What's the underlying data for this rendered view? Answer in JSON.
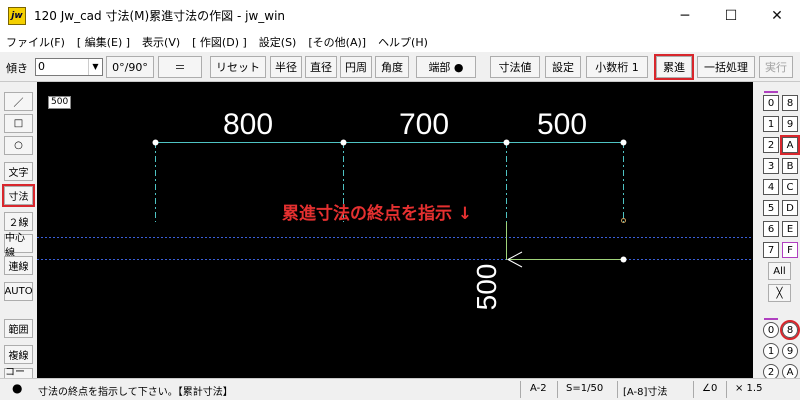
{
  "window": {
    "title": "120 Jw_cad 寸法(M)累進寸法の作図 - jw_win",
    "icon_text": "jw"
  },
  "menu": [
    "ファイル(F)",
    "[ 編集(E) ]",
    "表示(V)",
    "[ 作図(D) ]",
    "設定(S)",
    "[その他(A)]",
    "ヘルプ(H)"
  ],
  "toolbar": {
    "angle_label": "傾き",
    "angle_value": "0",
    "buttons": [
      "0°/90°",
      "＝",
      "リセット",
      "半径",
      "直径",
      "円周",
      "角度",
      "端部 ●",
      "寸法値",
      "設定",
      "小数桁 1",
      "累進",
      "一括処理",
      "実行"
    ]
  },
  "left_tools": [
    "／",
    "□",
    "○",
    "文字",
    "寸法",
    "２線",
    "中心線",
    "連線",
    "AUTO",
    "範囲",
    "複線",
    "コーナー"
  ],
  "right_panel": {
    "layers_left": [
      "0",
      "1",
      "2",
      "3",
      "4",
      "5",
      "6",
      "7"
    ],
    "layers_right": [
      "8",
      "9",
      "A",
      "B",
      "C",
      "D",
      "E",
      "F"
    ],
    "all_label": "All",
    "x_label": "╳",
    "groups_left": [
      "0",
      "1",
      "2"
    ],
    "groups_right": [
      "8",
      "9",
      "A"
    ]
  },
  "canvas": {
    "scale_tag": "500",
    "dim_top": [
      "800",
      "700",
      "500"
    ],
    "dim_vertical": "500",
    "instruction": "累進寸法の終点を指示 ↓"
  },
  "status": {
    "message": "寸法の終点を指示して下さい。【累計寸法】",
    "layer": "A-2",
    "scale": "S=1/50",
    "current": "[A-8]寸法",
    "angle": "∠0",
    "zoom": "× 1.5"
  },
  "colors": {
    "highlight": "#d8262c",
    "dim_line": "#4ec3c3",
    "guide": "#3a5fd8",
    "rubber": "#9fd37a",
    "instruction": "#e53030"
  }
}
